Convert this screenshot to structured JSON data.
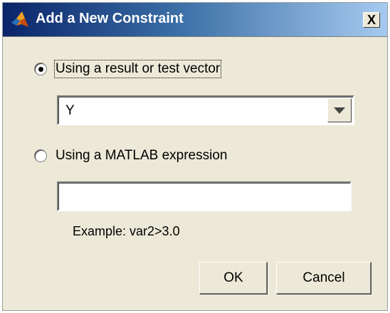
{
  "window": {
    "title": "Add a New Constraint",
    "icon": "matlab-logo-icon",
    "close_label": "X"
  },
  "options": {
    "result_vector": {
      "label": "Using a result or test vector",
      "selected": true
    },
    "matlab_expression": {
      "label": "Using a MATLAB expression",
      "selected": false
    }
  },
  "vector_select": {
    "value": "Y"
  },
  "expression_input": {
    "value": "",
    "placeholder": ""
  },
  "example_text": "Example: var2>3.0",
  "buttons": {
    "ok_label": "OK",
    "cancel_label": "Cancel"
  },
  "colors": {
    "title_gradient_start": "#0a246a",
    "title_gradient_end": "#a6caf0",
    "dialog_background": "#ece9d8"
  }
}
